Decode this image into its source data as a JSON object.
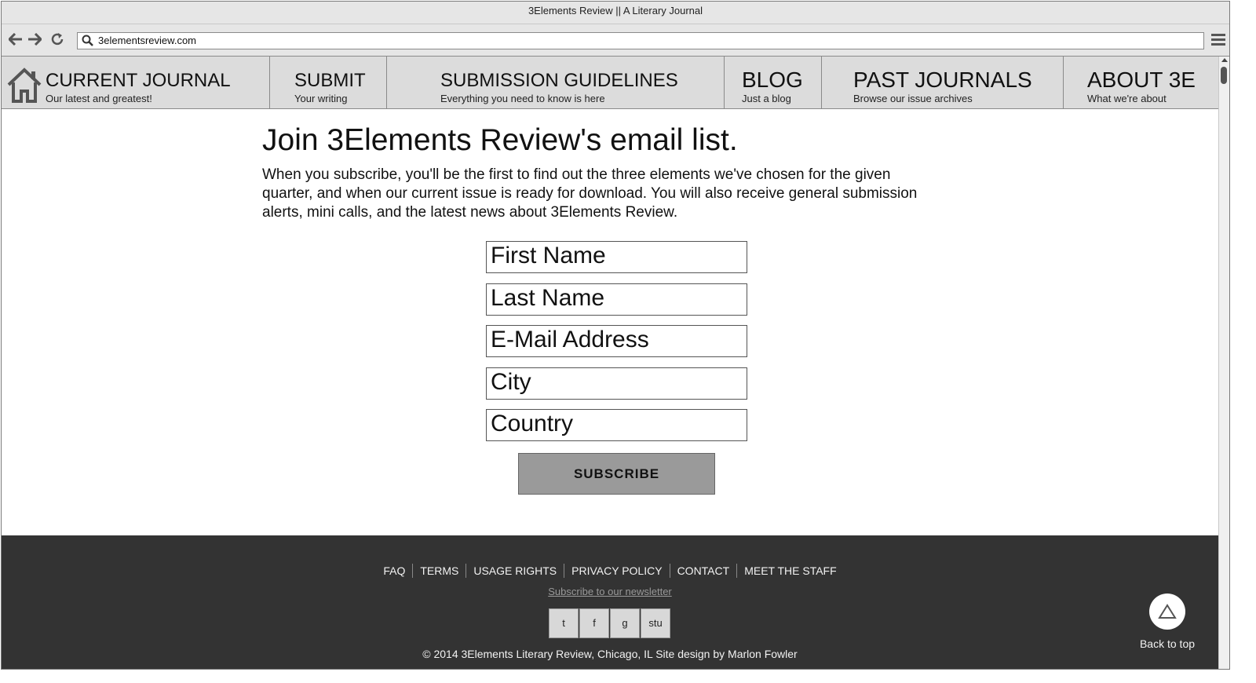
{
  "window": {
    "title": "3Elements Review || A Literary Journal"
  },
  "browser": {
    "url": "3elementsreview.com",
    "icons": [
      "back-arrow-icon",
      "forward-arrow-icon",
      "reload-icon",
      "search-icon",
      "hamburger-menu-icon"
    ]
  },
  "nav": {
    "items": [
      {
        "title": "CURRENT JOURNAL",
        "subtitle": "Our latest and greatest!",
        "icon": "home-icon"
      },
      {
        "title": "SUBMIT",
        "subtitle": "Your writing"
      },
      {
        "title": "SUBMISSION GUIDELINES",
        "subtitle": "Everything you need to know is here"
      },
      {
        "title": "BLOG",
        "subtitle": "Just a blog"
      },
      {
        "title": "PAST JOURNALS",
        "subtitle": "Browse our issue archives"
      },
      {
        "title": "ABOUT 3E",
        "subtitle": "What we're about"
      }
    ]
  },
  "main": {
    "heading": "Join 3Elements Review's email list.",
    "intro": "When you subscribe, you'll be the first to find out the three elements we've chosen for the given quarter, and when our current issue is ready for download. You will also receive general submission alerts, mini calls, and the latest news about 3Elements Review.",
    "form": {
      "first_name": "First Name",
      "last_name": "Last Name",
      "email": "E-Mail Address",
      "city": "City",
      "country": "Country",
      "submit_label": "SUBSCRIBE"
    }
  },
  "footer": {
    "links": [
      "FAQ",
      "TERMS",
      "USAGE RIGHTS",
      "PRIVACY POLICY",
      "CONTACT",
      "MEET THE STAFF"
    ],
    "newsletter": "Subscribe to our newsletter",
    "social": [
      "t",
      "f",
      "g",
      "stu"
    ],
    "copyright": "© 2014 3Elements Literary Review, Chicago, IL Site design by Marlon Fowler",
    "back_to_top": "Back to top"
  }
}
